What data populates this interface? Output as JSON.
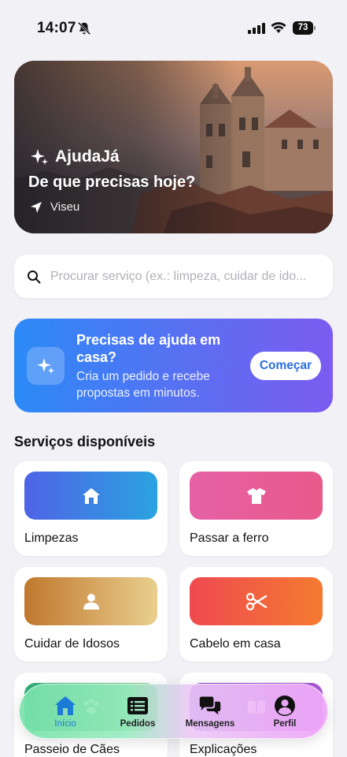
{
  "status_bar": {
    "time": "14:07",
    "battery": "73",
    "icons": [
      "bell-off-icon",
      "signal-icon",
      "wifi-icon",
      "battery-icon"
    ]
  },
  "hero": {
    "brand": "AjudaJá",
    "question": "De que precisas hoje?",
    "location": "Viseu",
    "icons": [
      "sparkles-icon",
      "location-arrow-icon"
    ]
  },
  "search": {
    "placeholder": "Procurar serviço (ex.: limpeza, cuidar de ido...",
    "value": ""
  },
  "promo": {
    "title": "Precisas de ajuda em casa?",
    "subtitle": "Cria um pedido e recebe propostas em minutos.",
    "button": "Começar",
    "icon": "sparkles-icon"
  },
  "services": {
    "title": "Serviços disponíveis",
    "items": [
      {
        "label": "Limpezas",
        "icon": "house-icon"
      },
      {
        "label": "Passar a ferro",
        "icon": "shirt-icon"
      },
      {
        "label": "Cuidar de Idosos",
        "icon": "person-icon"
      },
      {
        "label": "Cabelo em casa",
        "icon": "scissors-icon"
      },
      {
        "label": "Passeio de Cães",
        "icon": "paw-icon"
      },
      {
        "label": "Explicações",
        "icon": "book-icon"
      }
    ]
  },
  "tabbar": {
    "active": "Início",
    "tabs": [
      {
        "label": "Início",
        "icon": "home-icon"
      },
      {
        "label": "Pedidos",
        "icon": "list-icon"
      },
      {
        "label": "Mensagens",
        "icon": "chat-bubbles-icon"
      },
      {
        "label": "Perfil",
        "icon": "profile-icon"
      }
    ]
  },
  "colors": {
    "background": "#f1f1f6",
    "accent_blue": "#2b8af7",
    "accent_purple": "#7b5cf0",
    "tab_active": "#1d7bd8"
  }
}
